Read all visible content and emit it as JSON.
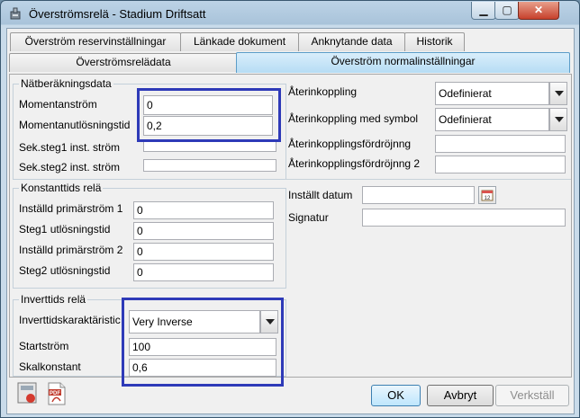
{
  "window": {
    "title": "Överströmsrelä - Stadium Driftsatt",
    "minimize": "▁",
    "maximize": "▢",
    "close": "✕"
  },
  "tabs_row1": [
    {
      "label": "Överström reservinställningar"
    },
    {
      "label": "Länkade dokument"
    },
    {
      "label": "Anknytande data"
    },
    {
      "label": "Historik"
    }
  ],
  "tabs_row2": [
    {
      "label": "Överströmsrelädata"
    },
    {
      "label": "Överström normalinställningar"
    }
  ],
  "natberakning": {
    "title": "Nätberäkningsdata",
    "momentanstrom_label": "Momentanström",
    "momentanstrom_value": "0",
    "momentanutlosningstid_label": "Momentanutlösningstid",
    "momentanutlosningstid_value": "0,2",
    "steg1_label": "Sek.steg1 inst. ström",
    "steg1_value": "",
    "steg2_label": "Sek.steg2 inst. ström",
    "steg2_value": ""
  },
  "konstanttid": {
    "title": "Konstanttids relä",
    "primar1_label": "Inställd primärström 1",
    "primar1_value": "0",
    "steg1tid_label": "Steg1 utlösningstid",
    "steg1tid_value": "0",
    "primar2_label": "Inställd primärström 2",
    "primar2_value": "0",
    "steg2tid_label": "Steg2 utlösningstid",
    "steg2tid_value": "0"
  },
  "inverttid": {
    "title": "Inverttids relä",
    "karakteristik_label": "Inverttidskaraktäristic",
    "karakteristik_value": "Very Inverse",
    "startstrom_label": "Startström",
    "startstrom_value": "100",
    "skalkonstant_label": "Skalkonstant",
    "skalkonstant_value": "0,6"
  },
  "aterkoppling": {
    "aterkoppling_label": "Återinkoppling",
    "aterkoppling_value": "Odefinierat",
    "symbol_label": "Återinkoppling med symbol",
    "symbol_value": "Odefinierat",
    "fordrojning_label": "Återinkopplingsfördröjnng",
    "fordrojning_value": "",
    "fordrojning2_label": "Återinkopplingsfördröjnng 2",
    "fordrojning2_value": ""
  },
  "signatur": {
    "datum_label": "Inställt datum",
    "datum_value": "",
    "signatur_label": "Signatur",
    "signatur_value": ""
  },
  "footer": {
    "ok": "OK",
    "cancel": "Avbryt",
    "apply": "Verkställ",
    "pdf_text": "PDF"
  },
  "colors": {
    "highlight": "#2e3ab8",
    "active_tab": "#b6dcf4"
  }
}
